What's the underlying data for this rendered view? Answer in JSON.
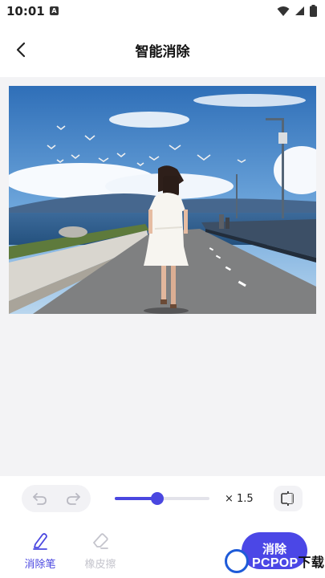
{
  "status": {
    "time": "10:01",
    "app_badge": "A"
  },
  "header": {
    "title": "智能消除"
  },
  "toolbar": {
    "zoom_label": "× 1.5",
    "brush_level": 0.45,
    "tools": [
      {
        "label": "消除笔",
        "active": true
      },
      {
        "label": "橡皮擦",
        "active": false
      }
    ],
    "erase_label": "消除"
  },
  "watermark": {
    "text": "PCPOP",
    "suffix": "下载"
  },
  "colors": {
    "accent": "#4a47e0",
    "canvas_bg": "#f3f3f5",
    "inactive": "#c4c4cc"
  }
}
